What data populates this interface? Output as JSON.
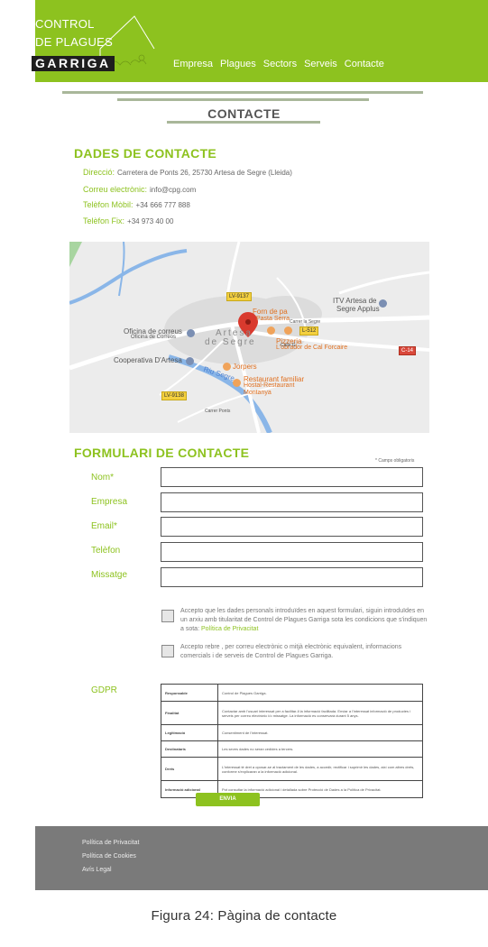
{
  "header": {
    "logo": {
      "line1": "CONTROL",
      "line2": "DE PLAGUES",
      "line3": "GARRIGA"
    },
    "nav": [
      "Empresa",
      "Plagues",
      "Sectors",
      "Serveis",
      "Contacte"
    ],
    "accent_color": "#8dc21f"
  },
  "page_title": "CONTACTE",
  "contact": {
    "heading": "DADES DE CONTACTE",
    "rows": [
      {
        "key": "Direcció:",
        "value": "Carretera de Ponts 26, 25730 Artesa de Segre (Lleida)"
      },
      {
        "key": "Correu electrònic:",
        "value": "info@cpg.com"
      },
      {
        "key": "Telèfon Mòbil:",
        "value": "+34 666 777 888"
      },
      {
        "key": "Telèfon Fix:",
        "value": "+34 973 40 00"
      }
    ]
  },
  "map": {
    "labels": {
      "forn": "Forn de pa",
      "forn2": "Pasta Serra",
      "itv": "ITV Artesa de",
      "itv2": "Segre Applus",
      "oficina": "Oficina de correus",
      "oficina2": "Oficina de Correos",
      "town1": "Artesa",
      "town2": "de Segre",
      "pizzeria": "Pizzeria",
      "pizzeria2": "L'obrador de Cal Forcaire",
      "cooperativa": "Cooperativa D'Artesa",
      "jorpers": "Jorpers",
      "restaurant": "Restaurant familiar",
      "restaurant2": "Hostal-Restaurant",
      "restaurant3": "Montanya",
      "riu": "Riu Segre",
      "carrer_segre": "Carrer la Segre",
      "calle": "Calle G",
      "carrer_ponts": "Carrer Ponts"
    },
    "roads": {
      "lv9137": "LV-9137",
      "l512": "L-512",
      "c14": "C-14",
      "lv9138": "LV-9138"
    }
  },
  "form": {
    "heading": "FORMULARI DE CONTACTE",
    "required_note": "* Camps obligatoris",
    "fields": [
      "Nom*",
      "Empresa",
      "Email*",
      "Telèfon",
      "Missatge"
    ],
    "consent1": "Accepto que les dades personals introduïdes en aquest formulari, siguin introduïdes en un arxiu amb titularitat de Control de Plagues Garriga sota les condicions que s'indiquen a sota:",
    "consent1_link": "Política de Privacitat",
    "consent2": "Accepto rebre , per correu electrònic o mitjà electrònic equivalent, informacions comercials i de serveis de Control de Plagues Garriga.",
    "gdpr_label": "GDPR",
    "gdpr_rows": [
      {
        "h": "Responsable",
        "v": "Control de Plagues Garriga."
      },
      {
        "h": "Finalitat",
        "v": "Contactar amb l'usuari interessat per a facilitar-li la informació facilitada. Enviar a l'interessat informació de productes i serveis per correu electrònic i/o missatge. La informació es conservarà durant 5 anys."
      },
      {
        "h": "Legitimació",
        "v": "Consentiment de l'interessat."
      },
      {
        "h": "Destinataris",
        "v": "Les seves dades no seran cedides a tercers."
      },
      {
        "h": "Drets",
        "v": "L'interessat té dret a oposar-se al tractament de les dades, a accedir, rectificar i suprimir les dades, així com altres drets, conforme s'explicaran a la informació adicional."
      },
      {
        "h": "Informació adicional",
        "v": "Pot consultar la informació adicional i detallada sobre Protecció de Dades a la Política de Privacitat."
      }
    ],
    "submit": "ENVIA"
  },
  "footer": {
    "links": [
      "Política de Privacitat",
      "Política de Cookies",
      "Avís Legal"
    ]
  },
  "caption": "Figura  24: Pàgina de contacte"
}
